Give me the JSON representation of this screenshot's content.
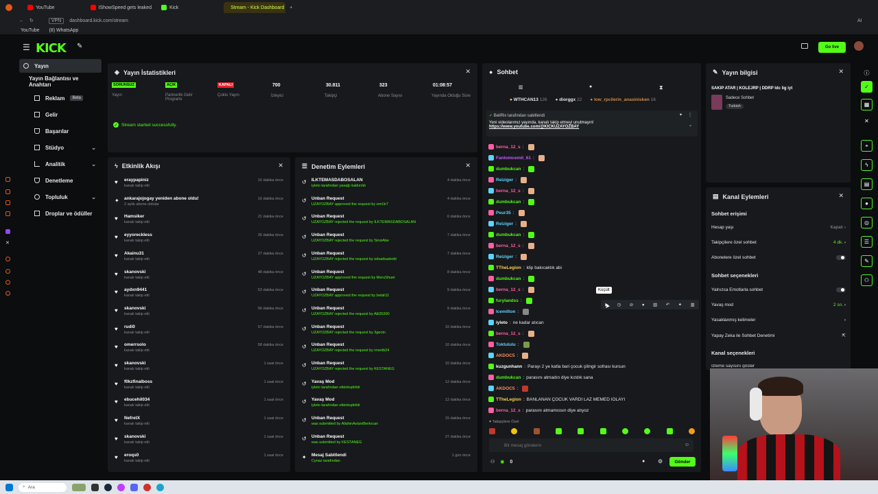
{
  "browser": {
    "tabs": [
      "YouTube",
      "IShowSpeed gets leaked",
      "Kick",
      "Stream - Kick Dashboard"
    ],
    "url": "dashboard.kick.com/stream",
    "bookmarks": [
      "YouTube",
      "(8) WhatsApp"
    ],
    "vpn": "VPN",
    "profile": "AI"
  },
  "header": {
    "logo": "KICK",
    "golive": "Go live"
  },
  "sidebar": {
    "items": [
      {
        "label": "Yayın"
      },
      {
        "label": "Yayın Bağlantısı ve Anahtarı"
      },
      {
        "label": "Reklam",
        "badge": "Beta"
      },
      {
        "label": "Gelir"
      },
      {
        "label": "Başarılar"
      },
      {
        "label": "Stüdyo"
      },
      {
        "label": "Analitik"
      },
      {
        "label": "Denetleme"
      },
      {
        "label": "Topluluk"
      },
      {
        "label": "Droplar ve ödüller"
      }
    ]
  },
  "stats": {
    "title": "Yayın İstatistikleri",
    "items": [
      {
        "value": "SORUNSUZ",
        "label": "Yayın",
        "color": "#53fc18"
      },
      {
        "value": "AÇIK",
        "label": "Partnerlik Gelir Programı",
        "color": "#53fc18"
      },
      {
        "value": "KAPALI",
        "label": "Çoklu Yayın",
        "color": "#e5212b"
      },
      {
        "value": "700",
        "label": "İzleyici"
      },
      {
        "value": "30.811",
        "label": "Takipçi"
      },
      {
        "value": "323",
        "label": "Abone Sayısı"
      },
      {
        "value": "01:08:57",
        "label": "Yayında Olduğu Süre"
      }
    ],
    "success": "Stream started successfully."
  },
  "activity": {
    "title": "Etkinlik Akışı",
    "rows": [
      {
        "name": "eraypapiniz",
        "sub": "kanalı takip etti",
        "time": "16 dakika önce"
      },
      {
        "name": "ankarajojogay yeniden abone oldu!",
        "sub": "2 aylık abone oldular",
        "time": "16 dakika önce"
      },
      {
        "name": "Hamsiker",
        "sub": "kanalı takip etti",
        "time": "21 dakika önce"
      },
      {
        "name": "eyyoreckless",
        "sub": "kanalı takip etti",
        "time": "26 dakika önce"
      },
      {
        "name": "Akainu31",
        "sub": "kanalı takip etti",
        "time": "27 dakika önce"
      },
      {
        "name": "skanovski",
        "sub": "kanalı takip etti",
        "time": "48 dakika önce"
      },
      {
        "name": "aydxn9441",
        "sub": "kanalı takip etti",
        "time": "53 dakika önce"
      },
      {
        "name": "skanovski",
        "sub": "kanalı takip etti",
        "time": "56 dakika önce"
      },
      {
        "name": "rudi0",
        "sub": "kanalı takip etti",
        "time": "57 dakika önce"
      },
      {
        "name": "omerrsolo",
        "sub": "kanalı takip etti",
        "time": "58 dakika önce"
      },
      {
        "name": "skanovski",
        "sub": "kanalı takip etti",
        "time": "1 saat önce"
      },
      {
        "name": "f0kzfinalboss",
        "sub": "kanalı takip etti",
        "time": "1 saat önce"
      },
      {
        "name": "ebucehil034",
        "sub": "kanalı takip etti",
        "time": "1 saat önce"
      },
      {
        "name": "NefretX",
        "sub": "kanalı takip etti",
        "time": "1 saat önce"
      },
      {
        "name": "skanovski",
        "sub": "kanalı takip etti",
        "time": "1 saat önce"
      },
      {
        "name": "eroqs0",
        "sub": "kanalı takip etti",
        "time": "1 saat önce"
      }
    ]
  },
  "moderation": {
    "title": "Denetim Eylemleri",
    "rows": [
      {
        "name": "ILKTEMASDABOSALAN",
        "sub": "iyleto tarafından yasağı kaldırıldı",
        "time": "4 dakika önce"
      },
      {
        "name": "Unban Request",
        "sub": "UZAYOZBAY approved the request by em1tr7",
        "time": "4 dakika önce"
      },
      {
        "name": "Unban Request",
        "sub": "UZAYOZBAY rejected the request by ILKTEMASDABOSALAN",
        "time": "6 dakika önce"
      },
      {
        "name": "Unban Request",
        "sub": "UZAYOZBAY rejected the request by SinsiAbe",
        "time": "7 dakika önce"
      },
      {
        "name": "Unban Request",
        "sub": "UZAYOZBAY rejected the request by sdsadsadsdd",
        "time": "7 dakika önce"
      },
      {
        "name": "Unban Request",
        "sub": "UZAYOZBAY approved the request by MeruShuet",
        "time": "8 dakika önce"
      },
      {
        "name": "Unban Request",
        "sub": "UZAYOZBAY approved the request by belali11",
        "time": "9 dakika önce"
      },
      {
        "name": "Unban Request",
        "sub": "UZAYOZBAY rejected the request by Alii35390",
        "time": "9 dakika önce"
      },
      {
        "name": "Unban Request",
        "sub": "UZAYOZBAY rejected the request by 3gectn",
        "time": "10 dakika önce"
      },
      {
        "name": "Unban Request",
        "sub": "UZAYOZBAY rejected the request by rmertb24",
        "time": "10 dakika önce"
      },
      {
        "name": "Unban Request",
        "sub": "UZAYOZBAY rejected the request by KESTANEG",
        "time": "10 dakika önce"
      },
      {
        "name": "Yavaş Mod",
        "sub": "iyleto tarafından etkinleştirildi",
        "time": "12 dakika önce"
      },
      {
        "name": "Yavaş Mod",
        "sub": "iyleto tarafından etkinleştirildi",
        "time": "12 dakika önce"
      },
      {
        "name": "Unban Request",
        "sub": "was submitted by AllahinAslaniBertocan",
        "time": "15 dakika önce"
      },
      {
        "name": "Unban Request",
        "sub": "was submitted by KESTANEG",
        "time": "27 dakika önce"
      },
      {
        "name": "Mesaj Sabitlendi",
        "sub": "Cynaz tarafından",
        "time": "1 gün önce"
      }
    ]
  },
  "chat": {
    "title": "Sohbet",
    "gifters": [
      {
        "name": "WTHCAN13",
        "count": "126"
      },
      {
        "name": "diorggx",
        "count": "22"
      },
      {
        "name": "low_rpcilerin_anasinisken",
        "count": "16"
      }
    ],
    "pinned": {
      "by": "BeliRix tarafından sabitlendi",
      "text": "Yeni videolarımız yayında, kanalı takip etmeyi unutmayın!",
      "link": "https://www.youtube.com/@KICKUZAYOZBAY"
    },
    "messages": [
      {
        "user": "berna_12_s",
        "color": "#ff5fa2",
        "text": ""
      },
      {
        "user": "Fantomcemil_61",
        "color": "#c25cff",
        "text": ""
      },
      {
        "user": "dumbukcan",
        "color": "#53fc18",
        "text": ""
      },
      {
        "user": "Reiziger",
        "color": "#5cd4ff",
        "text": ""
      },
      {
        "user": "berna_12_s",
        "color": "#ff5fa2",
        "text": ""
      },
      {
        "user": "dumbukcan",
        "color": "#53fc18",
        "text": ""
      },
      {
        "user": "Peur35",
        "color": "#5cd4ff",
        "text": ""
      },
      {
        "user": "Reiziger",
        "color": "#5cd4ff",
        "text": ""
      },
      {
        "user": "dumbukcan",
        "color": "#53fc18",
        "text": ""
      },
      {
        "user": "berna_12_s",
        "color": "#ff5fa2",
        "text": ""
      },
      {
        "user": "Reiziger",
        "color": "#5cd4ff",
        "text": ""
      },
      {
        "user": "TTheLegion",
        "color": "#ffd24d",
        "text": "klip bakıcaktık abi"
      },
      {
        "user": "dumbukcan",
        "color": "#53fc18",
        "text": ""
      },
      {
        "user": "berna_12_s",
        "color": "#ff5fa2",
        "text": ""
      },
      {
        "user": "furylandss",
        "color": "#53fc18",
        "text": ""
      },
      {
        "user": "Icemilton",
        "color": "#5cd4ff",
        "text": ""
      },
      {
        "user": "iyleto",
        "color": "#fff",
        "text": "ne kadar atıcan"
      },
      {
        "user": "berna_12_s",
        "color": "#ff5fa2",
        "text": ""
      },
      {
        "user": "Toktululu",
        "color": "#5cd4ff",
        "text": ""
      },
      {
        "user": "AKDOC5",
        "color": "#ff8f5c",
        "text": ""
      },
      {
        "user": "kuzgunhann",
        "color": "#fff",
        "text": "Parayı 2 ye katla bari çocuk çilingir sofrası kursun"
      },
      {
        "user": "dumbukcan",
        "color": "#53fc18",
        "text": "parasını atmadın diye kızdık sana"
      },
      {
        "user": "AKDOC5",
        "color": "#ff8f5c",
        "text": ""
      },
      {
        "user": "TTheLegion",
        "color": "#ffd24d",
        "text": "BANLANAN ÇOCUK VARDI LAZ MEMED IOLAYI"
      },
      {
        "user": "berna_12_s",
        "color": "#ff5fa2",
        "text": "parasını atmamıssın diye atıyoz"
      }
    ],
    "tooltip": "Küçült",
    "followers_label": "Takipçilere Özel",
    "input_placeholder": "Bir mesaj gönderin",
    "send": "Gönder",
    "points": "0"
  },
  "streaminfo": {
    "title": "Yayın bilgisi",
    "stream_title": "SAKIP ATAR | KOLEJRP | DDRP Idc lig iyt",
    "chat_mode": "Sadece Sohbet",
    "language": "Turkish"
  },
  "channel_actions": {
    "title": "Kanal Eylemleri",
    "section1": "Sohbet erişimi",
    "rows1": [
      {
        "label": "Hesap yaşı",
        "value": "Kapalı"
      },
      {
        "label": "Takipçilere özel sohbet",
        "value": "4 dk."
      },
      {
        "label": "Abonelere özel sohbet",
        "value": ""
      }
    ],
    "section2": "Sohbet seçenekleri",
    "rows2": [
      {
        "label": "Yalnızca Emotlarla sohbet",
        "value": ""
      },
      {
        "label": "Yavaş mod",
        "value": "2 sn."
      },
      {
        "label": "Yasaklanmış kelimeler",
        "value": ""
      },
      {
        "label": "Yapay Zeka ile Sohbet Denetimi",
        "value": ""
      }
    ],
    "section3": "Kanal seçenekleri",
    "partial": "İzleme sayısını göster"
  },
  "taskbar": {
    "search": "Ara"
  }
}
